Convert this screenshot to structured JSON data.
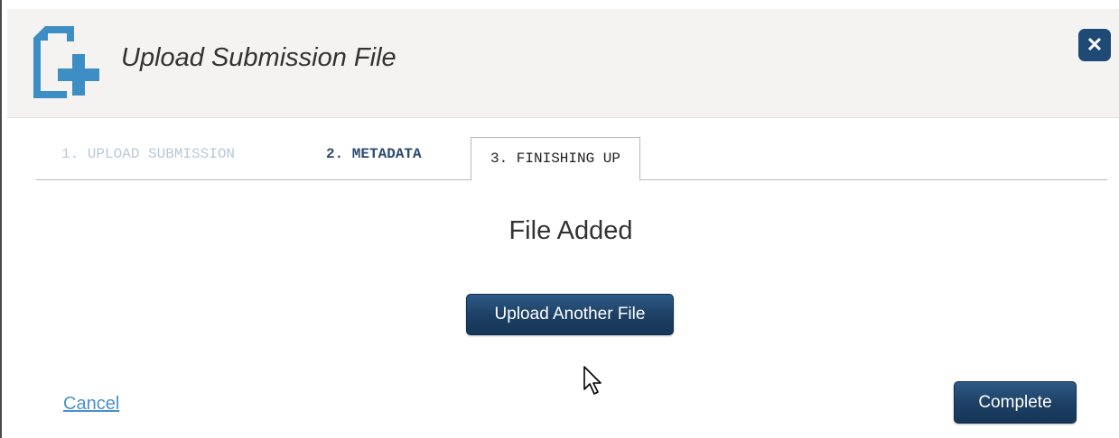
{
  "dialog": {
    "title": "Upload Submission File",
    "close_label": "✕"
  },
  "tabs": [
    {
      "label": "1. UPLOAD SUBMISSION",
      "state": "completed"
    },
    {
      "label": "2. METADATA",
      "state": "visited"
    },
    {
      "label": "3. FINISHING UP",
      "state": "active"
    }
  ],
  "body": {
    "heading": "File Added",
    "upload_another_label": "Upload Another File"
  },
  "footer": {
    "cancel_label": "Cancel",
    "complete_label": "Complete"
  },
  "icons": {
    "header": "file-add-icon",
    "close": "close-icon",
    "cursor": "mouse-pointer-icon"
  },
  "colors": {
    "accent_icon": "#3d8ec4",
    "button_dark": "#1e4a75",
    "link": "#4a90c9",
    "header_bg": "#f4f3f2"
  }
}
